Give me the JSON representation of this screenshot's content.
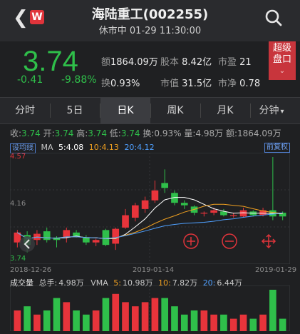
{
  "header": {
    "back_icon": "chevron-left-icon",
    "logo_text": "W",
    "title": "海陆重工(002255)",
    "subtitle": "休市中 01-29 11:30:00",
    "search_icon": "search-icon"
  },
  "quote": {
    "price": "3.74",
    "change": "-0.41",
    "change_pct": "-9.88%",
    "stats": [
      {
        "k": "额",
        "v": "1864.09万"
      },
      {
        "k": "股本",
        "v": "8.42亿"
      },
      {
        "k": "市盈",
        "v": "21"
      },
      {
        "k": "换",
        "v": "0.93%"
      },
      {
        "k": "市值",
        "v": "31.5亿"
      },
      {
        "k": "市净",
        "v": "0.78"
      }
    ],
    "super_label_1": "超级",
    "super_label_2": "盘口"
  },
  "tabs": [
    {
      "label": "分时"
    },
    {
      "label": "5日"
    },
    {
      "label": "日K"
    },
    {
      "label": "周K"
    },
    {
      "label": "月K"
    },
    {
      "label": "分钟"
    }
  ],
  "tab_arrow": "▾",
  "info": {
    "open_k": "收:",
    "open_v": "3.74",
    "kai_k": "开:",
    "kai_v": "3.74",
    "high_k": "高:",
    "high_v": "3.74",
    "low_k": "低:",
    "low_v": "3.74",
    "turn_k": "换:",
    "turn_v": "0.93%",
    "vol_k": "量:",
    "vol_v": "4.98万",
    "amt_k": "额:",
    "amt_v": "1864.09万"
  },
  "ma": {
    "tag": "设均线",
    "label": "MA",
    "ma5_k": "5:",
    "ma5_v": "4.08",
    "ma10_k": "10:",
    "ma10_v": "4.13",
    "ma20_k": "20:",
    "ma20_v": "4.12",
    "right_tag": "前复权"
  },
  "chart_axis": {
    "top": "4.57",
    "mid": "4.16",
    "bottom": "3.74",
    "d1": "2018-12-26",
    "d2": "2019-01-14",
    "d3": "2019-01-29"
  },
  "volume": {
    "label": "成交量",
    "total_k": "总手:",
    "total_v": "4.98万",
    "vma_k": "VMA",
    "v5_k": "5:",
    "v5_v": "10.98万",
    "v10_k": "10:",
    "v10_v": "7.82万",
    "v20_k": "20:",
    "v20_v": "6.44万"
  },
  "colors": {
    "up": "#e8343b",
    "down": "#2fbf4a",
    "ma5": "#ffffff",
    "ma10": "#f0a020",
    "ma20": "#4fa0ff"
  },
  "chart_data": {
    "type": "candlestick",
    "ylim": [
      3.74,
      4.57
    ],
    "candles": [
      {
        "o": 3.88,
        "c": 3.96,
        "h": 3.98,
        "l": 3.84
      },
      {
        "o": 3.94,
        "c": 3.86,
        "h": 3.97,
        "l": 3.8
      },
      {
        "o": 3.9,
        "c": 3.95,
        "h": 3.98,
        "l": 3.86
      },
      {
        "o": 3.97,
        "c": 3.9,
        "h": 4.0,
        "l": 3.88
      },
      {
        "o": 3.92,
        "c": 3.9,
        "h": 3.93,
        "l": 3.84
      },
      {
        "o": 3.92,
        "c": 3.98,
        "h": 4.0,
        "l": 3.88
      },
      {
        "o": 3.96,
        "c": 3.93,
        "h": 3.98,
        "l": 3.92
      },
      {
        "o": 3.92,
        "c": 3.88,
        "h": 3.94,
        "l": 3.86
      },
      {
        "o": 3.88,
        "c": 3.9,
        "h": 3.91,
        "l": 3.85
      },
      {
        "o": 3.98,
        "c": 3.86,
        "h": 3.99,
        "l": 3.85
      },
      {
        "o": 3.87,
        "c": 3.99,
        "h": 4.0,
        "l": 3.82
      },
      {
        "o": 4.0,
        "c": 4.1,
        "h": 4.15,
        "l": 3.99
      },
      {
        "o": 4.08,
        "c": 4.18,
        "h": 4.2,
        "l": 4.05
      },
      {
        "o": 4.15,
        "c": 4.22,
        "h": 4.25,
        "l": 4.12
      },
      {
        "o": 4.22,
        "c": 4.3,
        "h": 4.38,
        "l": 4.2
      },
      {
        "o": 4.36,
        "c": 4.32,
        "h": 4.47,
        "l": 4.28
      },
      {
        "o": 4.28,
        "c": 4.2,
        "h": 4.3,
        "l": 4.18
      },
      {
        "o": 4.2,
        "c": 4.18,
        "h": 4.22,
        "l": 4.15
      },
      {
        "o": 4.17,
        "c": 4.12,
        "h": 4.18,
        "l": 4.1
      },
      {
        "o": 4.12,
        "c": 4.12,
        "h": 4.13,
        "l": 4.09
      },
      {
        "o": 4.12,
        "c": 4.14,
        "h": 4.16,
        "l": 4.1
      },
      {
        "o": 4.13,
        "c": 4.1,
        "h": 4.15,
        "l": 4.09
      },
      {
        "o": 4.1,
        "c": 4.1,
        "h": 4.12,
        "l": 4.08
      },
      {
        "o": 4.09,
        "c": 4.14,
        "h": 4.16,
        "l": 4.08
      },
      {
        "o": 4.13,
        "c": 4.1,
        "h": 4.14,
        "l": 4.09
      },
      {
        "o": 4.1,
        "c": 4.14,
        "h": 4.16,
        "l": 4.09
      },
      {
        "o": 4.14,
        "c": 4.09,
        "h": 4.57,
        "l": 4.06
      },
      {
        "o": 4.12,
        "c": 4.09,
        "h": 4.13,
        "l": 4.06
      }
    ],
    "volumes": [
      0.5,
      0.6,
      0.4,
      0.5,
      0.8,
      0.7,
      0.5,
      0.4,
      0.5,
      0.8,
      0.9,
      0.7,
      0.6,
      0.7,
      0.8,
      0.8,
      0.6,
      0.4,
      0.5,
      0.5,
      0.4,
      0.4,
      0.3,
      0.4,
      0.3,
      0.4,
      1.0,
      0.3
    ]
  }
}
